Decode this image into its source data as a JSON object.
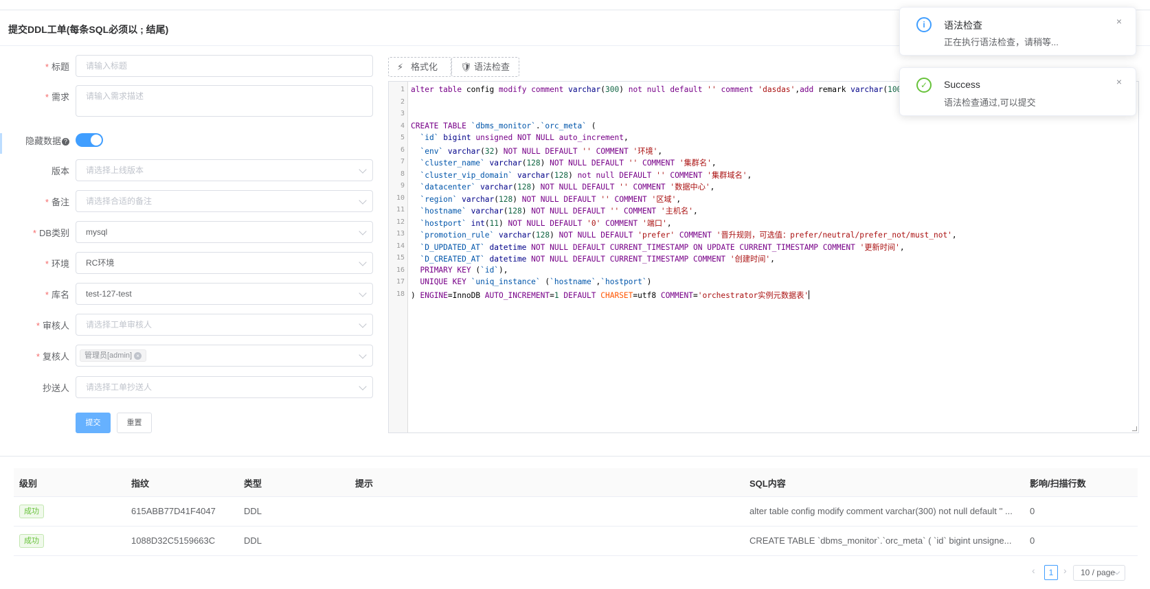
{
  "card": {
    "title": "提交DDL工单(每条SQL必须以 ; 结尾)"
  },
  "form": {
    "title": {
      "label": "标题",
      "placeholder": "请输入标题"
    },
    "requirement": {
      "label": "需求",
      "placeholder": "请输入需求描述"
    },
    "hide_data": {
      "label": "隐藏数据",
      "help": "?",
      "enabled": true
    },
    "version": {
      "label": "版本",
      "placeholder": "请选择上线版本"
    },
    "remark": {
      "label": "备注",
      "placeholder": "请选择合适的备注"
    },
    "db_type": {
      "label": "DB类别",
      "value": "mysql"
    },
    "env": {
      "label": "环境",
      "value": "RC环境"
    },
    "database": {
      "label": "库名",
      "value": "test-127-test"
    },
    "reviewer": {
      "label": "审核人",
      "placeholder": "请选择工单审核人"
    },
    "rechecker": {
      "label": "复核人",
      "tag": "管理员[admin]",
      "tag_close": "×"
    },
    "cc": {
      "label": "抄送人",
      "placeholder": "请选择工单抄送人"
    },
    "submit_label": "提交",
    "reset_label": "重置",
    "required_mark": "*"
  },
  "toolbar": {
    "format_label": "格式化",
    "format_icon": "⚡",
    "syntax_label": "语法检查",
    "syntax_icon": "🛡"
  },
  "editor": {
    "line_numbers": [
      "1",
      "2",
      "3",
      "4",
      "5",
      "6",
      "7",
      "8",
      "9",
      "10",
      "11",
      "12",
      "13",
      "14",
      "15",
      "16",
      "17",
      "18"
    ]
  },
  "table": {
    "headers": {
      "level": "级别",
      "fingerprint": "指纹",
      "type": "类型",
      "hint": "提示",
      "sql": "SQL内容",
      "rows": "影响/扫描行数"
    },
    "rows": [
      {
        "level": "成功",
        "fingerprint": "615ABB77D41F4047",
        "type": "DDL",
        "hint": "",
        "sql": "alter table config modify comment varchar(300) not null default '' ...",
        "rows": "0"
      },
      {
        "level": "成功",
        "fingerprint": "1088D32C5159663C",
        "type": "DDL",
        "hint": "",
        "sql": "CREATE TABLE `dbms_monitor`.`orc_meta` ( `id` bigint unsigne...",
        "rows": "0"
      }
    ]
  },
  "pagination": {
    "prev": "‹",
    "current": "1",
    "next": "›",
    "page_size": "10 / page"
  },
  "notifications": [
    {
      "icon": "info-icon",
      "title": "语法检查",
      "message": "正在执行语法检查，请稍等...",
      "close": "×"
    },
    {
      "icon": "success-icon",
      "title": "Success",
      "message": "语法检查通过,可以提交",
      "close": "×"
    }
  ],
  "colors": {
    "primary": "#409eff",
    "success": "#67c23a",
    "danger": "#f56c6c"
  }
}
